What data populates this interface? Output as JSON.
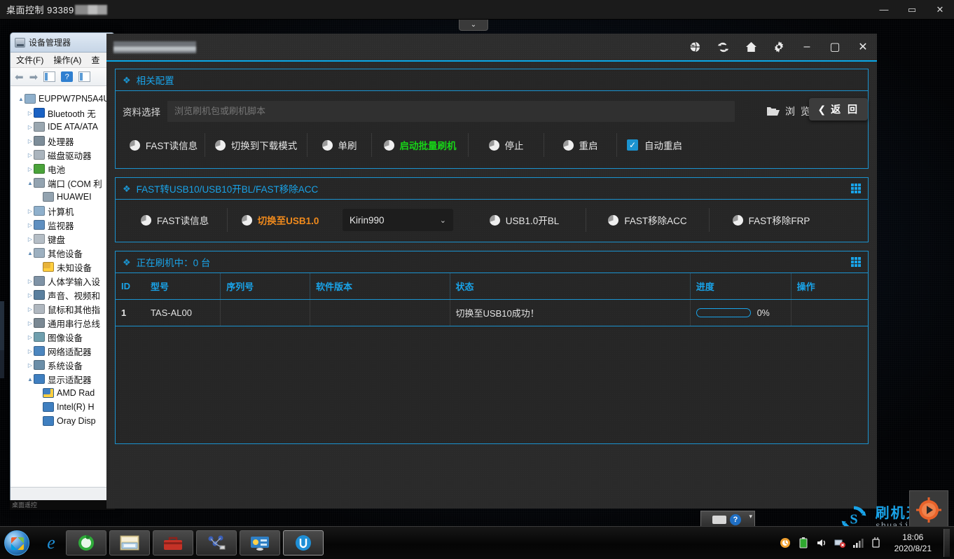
{
  "remote_window": {
    "title": "桌面控制 93389",
    "title_redacted": true,
    "buttons": {
      "minimize": "—",
      "maximize": "▭",
      "close": "✕"
    }
  },
  "toolbar_tab": {
    "icon": "chevron-down-icon",
    "glyph": "⌄"
  },
  "device_manager": {
    "title": "设备管理器",
    "menu": [
      "文件(F)",
      "操作(A)",
      "查"
    ],
    "toolbar_icons": [
      "back-arrow-icon",
      "forward-arrow-icon",
      "properties-icon",
      "help-icon",
      "panel-icon"
    ],
    "tree": [
      {
        "label": "EUPPW7PN5A4U",
        "indent": 0,
        "expander": "▲",
        "icon": "computer-icon"
      },
      {
        "label": "Bluetooth 无",
        "indent": 1,
        "expander": "▷",
        "icon": "bluetooth-icon"
      },
      {
        "label": "IDE ATA/ATA",
        "indent": 1,
        "expander": "▷",
        "icon": "ide-controller-icon"
      },
      {
        "label": "处理器",
        "indent": 1,
        "expander": "▷",
        "icon": "processor-icon"
      },
      {
        "label": "磁盘驱动器",
        "indent": 1,
        "expander": "▷",
        "icon": "disk-drive-icon"
      },
      {
        "label": "电池",
        "indent": 1,
        "expander": "▷",
        "icon": "battery-icon"
      },
      {
        "label": "端口 (COM 利",
        "indent": 1,
        "expander": "▲",
        "icon": "port-icon"
      },
      {
        "label": "HUAWEI",
        "indent": 2,
        "expander": "",
        "icon": "port-icon"
      },
      {
        "label": "计算机",
        "indent": 1,
        "expander": "▷",
        "icon": "computer-icon"
      },
      {
        "label": "监视器",
        "indent": 1,
        "expander": "▷",
        "icon": "monitor-icon"
      },
      {
        "label": "键盘",
        "indent": 1,
        "expander": "▷",
        "icon": "keyboard-icon"
      },
      {
        "label": "其他设备",
        "indent": 1,
        "expander": "▲",
        "icon": "other-device-icon"
      },
      {
        "label": "未知设备",
        "indent": 2,
        "expander": "",
        "icon": "warning-device-icon"
      },
      {
        "label": "人体学输入设",
        "indent": 1,
        "expander": "▷",
        "icon": "hid-icon"
      },
      {
        "label": "声音、视频和",
        "indent": 1,
        "expander": "▷",
        "icon": "sound-icon"
      },
      {
        "label": "鼠标和其他指",
        "indent": 1,
        "expander": "▷",
        "icon": "mouse-icon"
      },
      {
        "label": "通用串行总线",
        "indent": 1,
        "expander": "▷",
        "icon": "usb-icon"
      },
      {
        "label": "图像设备",
        "indent": 1,
        "expander": "▷",
        "icon": "imaging-icon"
      },
      {
        "label": "网络适配器",
        "indent": 1,
        "expander": "▷",
        "icon": "network-icon"
      },
      {
        "label": "系统设备",
        "indent": 1,
        "expander": "▷",
        "icon": "system-device-icon"
      },
      {
        "label": "显示适配器",
        "indent": 1,
        "expander": "▲",
        "icon": "display-adapter-icon"
      },
      {
        "label": "AMD Rad",
        "indent": 2,
        "expander": "",
        "icon": "display-warning-icon"
      },
      {
        "label": "Intel(R) H",
        "indent": 2,
        "expander": "",
        "icon": "display-adapter-icon"
      },
      {
        "label": "Oray Disp",
        "indent": 2,
        "expander": "",
        "icon": "display-adapter-icon"
      }
    ],
    "status_text": "桌面遥控"
  },
  "app": {
    "title_redacted": true,
    "titlebar_icons": [
      "globe-icon",
      "refresh-icon",
      "home-icon",
      "gear-icon"
    ],
    "window_buttons": {
      "minimize": "–",
      "maximize": "▢",
      "close": "✕"
    },
    "back_button": {
      "label": "返 回",
      "chevron": "❮"
    },
    "panel_config": {
      "title": "相关配置",
      "file_label": "资料选择",
      "file_placeholder": "浏览刷机包或刷机脚本",
      "file_value": "",
      "browse_label": "浏 览",
      "buttons": [
        {
          "label": "FAST读信息",
          "style": "normal"
        },
        {
          "label": "切换到下载模式",
          "style": "normal"
        },
        {
          "label": "单刷",
          "style": "normal"
        },
        {
          "label": "启动批量刷机",
          "style": "green"
        },
        {
          "label": "停止",
          "style": "normal"
        },
        {
          "label": "重启",
          "style": "normal"
        }
      ],
      "checkbox": {
        "label": "自动重启",
        "checked": true,
        "mark": "✓"
      }
    },
    "panel_usb": {
      "title": "FAST转USB10/USB10开BL/FAST移除ACC",
      "buttons_left": [
        {
          "label": "FAST读信息",
          "style": "normal"
        },
        {
          "label": "切换至USB1.0",
          "style": "orange"
        }
      ],
      "select": {
        "value": "Kirin990",
        "caret": "⌄"
      },
      "buttons_right": [
        {
          "label": "USB1.0开BL",
          "style": "normal"
        },
        {
          "label": "FAST移除ACC",
          "style": "normal"
        },
        {
          "label": "FAST移除FRP",
          "style": "normal"
        }
      ]
    },
    "panel_table": {
      "title": "正在刷机中：0 台",
      "columns": [
        "ID",
        "型号",
        "序列号",
        "软件版本",
        "状态",
        "进度",
        "操作"
      ],
      "rows": [
        {
          "id": "1",
          "model": "TAS-AL00",
          "serial": "",
          "version": "",
          "status": "切换至USB10成功！",
          "progress": "0%",
          "progress_value": 0,
          "action": ""
        }
      ]
    }
  },
  "watermark": {
    "title": "刷机天堂",
    "url": "shuajitt.com"
  },
  "mini_toolbar": {
    "icons": [
      "keyboard-icon",
      "help-icon"
    ],
    "help_glyph": "?",
    "caret": "▾"
  },
  "taskbar": {
    "start_label": "start-orb",
    "items": [
      {
        "name": "internet-explorer-icon",
        "glyph": "e"
      },
      {
        "name": "browser-360-icon",
        "glyph": ""
      },
      {
        "name": "file-explorer-icon",
        "glyph": ""
      },
      {
        "name": "toolbox-icon",
        "glyph": ""
      },
      {
        "name": "network-map-icon",
        "glyph": ""
      },
      {
        "name": "control-panel-icon",
        "glyph": ""
      },
      {
        "name": "sunlogin-icon",
        "glyph": "U"
      }
    ],
    "tray_icons": [
      "antivirus-icon",
      "battery-icon",
      "volume-icon",
      "network-error-icon",
      "signal-icon",
      "power-icon"
    ],
    "clock_time": "18:06",
    "clock_date": "2020/8/21"
  },
  "colors": {
    "accent_blue": "#19a3e8",
    "panel_border": "#1b93cf",
    "green": "#17d417",
    "orange": "#f08a1c",
    "window_bg": "#2a2a2a"
  }
}
